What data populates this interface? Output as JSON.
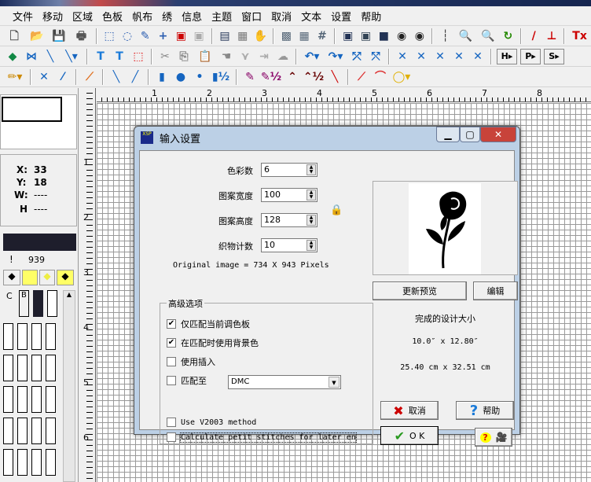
{
  "menu": [
    "文件",
    "移动",
    "区域",
    "色板",
    "帆布",
    "绣",
    "信息",
    "主题",
    "窗口",
    "取消",
    "文本",
    "设置",
    "帮助"
  ],
  "toolbar_rows": [
    [
      "new-file",
      "open-folder",
      "save",
      "print",
      "|",
      "rect-select",
      "lasso-select",
      "magic-wand",
      "crosshair",
      "add-image",
      "remove-image",
      "|",
      "calendar",
      "photo",
      "hand",
      "|",
      "grid-small",
      "grid-medium",
      "grid-large",
      "|",
      "view1",
      "view2",
      "view3",
      "view4",
      "view5",
      "|",
      "ruler",
      "zoom-in",
      "zoom-out",
      "refresh",
      "|",
      "color-picker",
      "pin",
      "|",
      "clear-text"
    ],
    [
      "fill",
      "nodes",
      "needle",
      "needle-dropdown",
      "|",
      "text-t",
      "text-t-bold",
      "dotted-rect",
      "|",
      "cut",
      "copy",
      "paste",
      "hand-paste",
      "paste-special",
      "paste-into",
      "brain",
      "|",
      "undo",
      "redo",
      "flip-x",
      "flip-y",
      "|",
      "cross1",
      "cross2",
      "cross3",
      "cross4",
      "cross5",
      "|",
      "h-button",
      "p-button",
      "s-button"
    ],
    [
      "pencil",
      "|",
      "full-cross",
      "half-cross",
      "|",
      "quarter-stitch",
      "|",
      "back-stitch-left",
      "back-stitch-right",
      "|",
      "bead-long",
      "french-knot",
      "bead",
      "half-bead",
      "|",
      "pen-underline",
      "pen-half",
      "angle",
      "angle-half",
      "marker",
      "|",
      "line-red",
      "arc-red",
      "circle-yellow"
    ]
  ],
  "text_buttons": {
    "h-button": "H",
    "p-button": "P",
    "s-button": "S"
  },
  "ruler_h": [
    "1",
    "2",
    "3",
    "4",
    "5",
    "6",
    "7",
    "8"
  ],
  "ruler_v": [
    "1",
    "2",
    "3",
    "4",
    "5",
    "6"
  ],
  "coords": {
    "x_label": "X:",
    "x": "33",
    "y_label": "Y:",
    "y": "18",
    "w_label": "W:",
    "w": "----",
    "h_label": "H",
    "h": "----"
  },
  "palette": {
    "symbol": "!",
    "code": "939",
    "col_c": "C",
    "col_b": "B",
    "color": "#1e1e2c"
  },
  "dialog": {
    "title": "输入设置",
    "fields": [
      {
        "label": "色彩数",
        "value": "6"
      },
      {
        "label": "图案宽度",
        "value": "100"
      },
      {
        "label": "图案高度",
        "value": "128"
      },
      {
        "label": "织物计数",
        "value": "10"
      }
    ],
    "original": "Original image = 734 X 943 Pixels",
    "group_title": "高级选项",
    "options": [
      {
        "label": "仅匹配当前调色板",
        "checked": true
      },
      {
        "label": "在匹配时使用背景色",
        "checked": true
      },
      {
        "label": "使用插入",
        "checked": false
      },
      {
        "label": "匹配至",
        "checked": false
      }
    ],
    "match_select": "DMC",
    "v2003": "Use V2003 method",
    "petit": "Calculate petit stitches for later en",
    "update_preview": "更新预览",
    "edit": "编辑",
    "size_title": "完成的设计大小",
    "size_in": "10.0″ x 12.80″",
    "size_cm": "25.40 cm  x 32.51 cm",
    "cancel": "取消",
    "help": "帮助",
    "ok": "O K"
  }
}
